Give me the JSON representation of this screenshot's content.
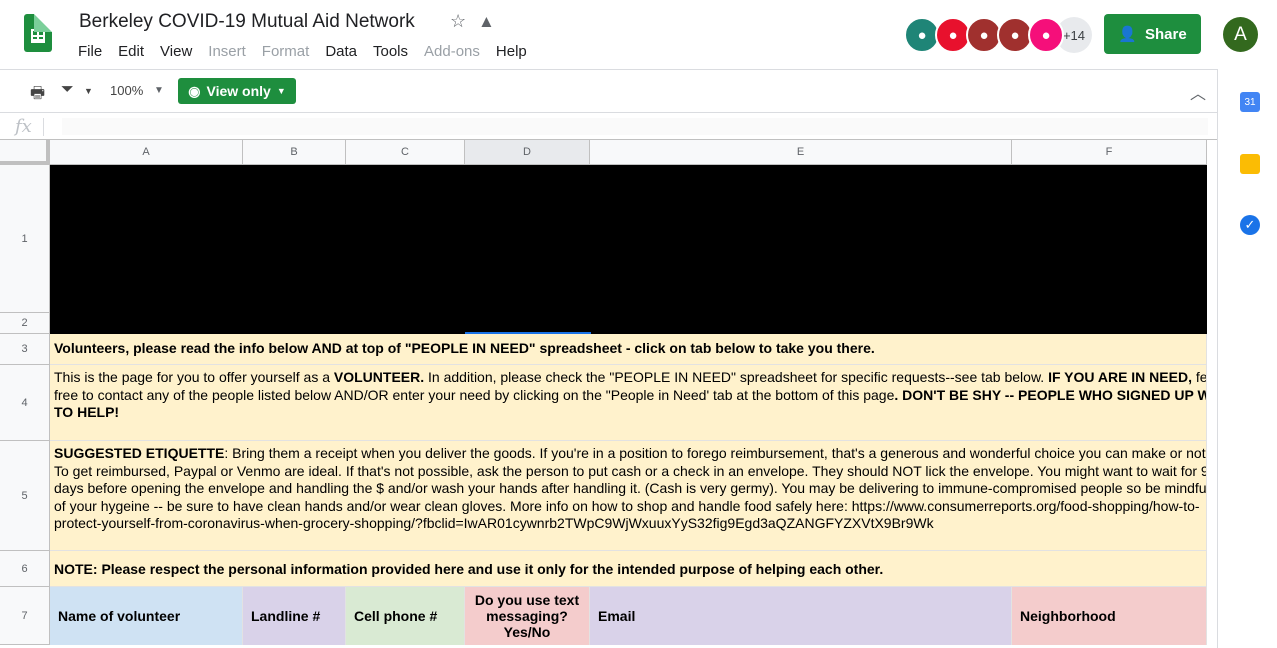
{
  "app": {
    "title": "Berkeley COVID-19 Mutual Aid Network",
    "menu": [
      {
        "label": "File",
        "disabled": false
      },
      {
        "label": "Edit",
        "disabled": false
      },
      {
        "label": "View",
        "disabled": false
      },
      {
        "label": "Insert",
        "disabled": true
      },
      {
        "label": "Format",
        "disabled": true
      },
      {
        "label": "Data",
        "disabled": false
      },
      {
        "label": "Tools",
        "disabled": false
      },
      {
        "label": "Add-ons",
        "disabled": true
      },
      {
        "label": "Help",
        "disabled": false
      }
    ],
    "collaborators": [
      {
        "color": "#1f8577",
        "icon": "dalmatian-icon"
      },
      {
        "color": "#e8112d",
        "icon": "dinosaur-icon"
      },
      {
        "color": "#a0302e",
        "icon": "dinosaur-icon"
      },
      {
        "color": "#a0302e",
        "icon": "hippo-icon"
      },
      {
        "color": "#f50f7a",
        "icon": "bear-icon"
      }
    ],
    "more_collaborators": "+14",
    "share_label": "Share",
    "account_initial": "A"
  },
  "toolbar": {
    "zoom": "100%",
    "view_only": "View only",
    "fx": "fx"
  },
  "columns": [
    "A",
    "B",
    "C",
    "D",
    "E",
    "F"
  ],
  "rows": [
    "1",
    "2",
    "3",
    "4",
    "5",
    "6",
    "7"
  ],
  "sheet": {
    "row3": [
      {
        "t": "Volunteers, please read the info below AND at top of \"PEOPLE IN NEED\" spreadsheet - click on tab below to take you there.",
        "b": true
      }
    ],
    "row4": [
      {
        "t": "This is the page for you to offer yourself as a ",
        "b": false
      },
      {
        "t": "VOLUNTEER.",
        "b": true
      },
      {
        "t": " In addition, please check the \"PEOPLE IN NEED\" spreadsheet for specific requests--see tab below. ",
        "b": false
      },
      {
        "t": "IF YOU ARE IN NEED,",
        "b": true
      },
      {
        "t": " feel free to contact any of the people listed below AND/OR enter your need by clicking on the \"People in Need' tab at the bottom of this page",
        "b": false
      },
      {
        "t": ". DON'T BE SHY -- PEOPLE WHO SIGNED UP WANT TO HELP!",
        "b": true
      }
    ],
    "row5": [
      {
        "t": "SUGGESTED ETIQUETTE",
        "b": true
      },
      {
        "t": ": Bring them a receipt when you deliver the goods. If you're in a position to forego reimbursement, that's a generous and wonderful choice you can make or not. To get reimbursed, Paypal or Venmo are ideal. If that's not possible, ask the person to put cash or a check in an envelope. They should NOT lick the envelope. You might want to wait for 9 days before opening the envelope and handling the $ and/or wash your hands after handling it. (Cash is very germy). You may be delivering to immune-compromised people so be mindful of your hygeine -- be sure to have clean hands and/or wear clean gloves. More info on how to shop and handle food safely here: https://www.consumerreports.org/food-shopping/how-to-protect-yourself-from-coronavirus-when-grocery-shopping/?fbclid=IwAR01cywnrb2TWpC9WjWxuuxYyS32fig9Egd3aQZANGFYZXVtX9Br9Wk",
        "b": false
      }
    ],
    "row6": [
      {
        "t": "NOTE: Please respect the personal information provided here and use it only for the intended purpose of helping each other.",
        "b": true
      }
    ],
    "headers": [
      {
        "label": "Name of volunteer",
        "color": "#cfe2f3"
      },
      {
        "label": "Landline #",
        "color": "#d9d2e9"
      },
      {
        "label": "Cell phone #",
        "color": "#d9ead3"
      },
      {
        "label": "Do you use text messaging? Yes/No",
        "color": "#f4cccc"
      },
      {
        "label": "Email",
        "color": "#d9d2e9"
      },
      {
        "label": "Neighborhood",
        "color": "#f4cccc"
      }
    ]
  }
}
